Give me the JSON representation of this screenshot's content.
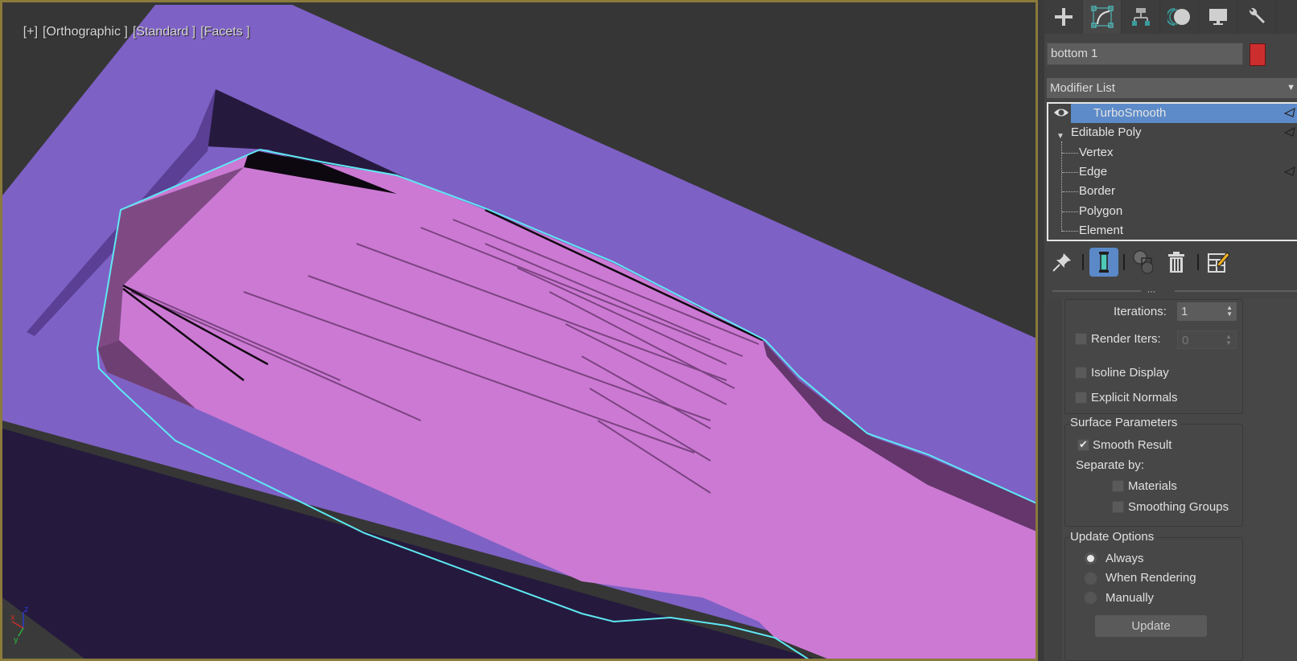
{
  "viewport": {
    "labels": [
      "[+]",
      "[Orthographic ]",
      "[Standard ]",
      "[Facets ]"
    ],
    "gizmo_axes": {
      "x": "x",
      "y": "y",
      "z": "z"
    },
    "colors": {
      "background": "#363636",
      "mold_top": "#7e61c5",
      "mold_shadow": "#251a3d",
      "mold_inner_edge": "#5a3f95",
      "object": "#cc79d4",
      "object_dark": "#7f4a84",
      "selection_outline": "#5ee8f2",
      "frame": "#8a7a3c"
    }
  },
  "command_panel": {
    "tabs": [
      {
        "name": "create",
        "icon": "plus-icon"
      },
      {
        "name": "modify",
        "icon": "modify-curve-icon",
        "active": true
      },
      {
        "name": "hierarchy",
        "icon": "hierarchy-icon"
      },
      {
        "name": "motion",
        "icon": "motion-icon"
      },
      {
        "name": "display",
        "icon": "monitor-icon"
      },
      {
        "name": "utilities",
        "icon": "wrench-icon"
      }
    ],
    "object_name": "bottom 1",
    "object_color": "#cc2e2e",
    "modifier_list_label": "Modifier List",
    "stack": {
      "items": [
        {
          "label": "TurboSmooth",
          "selected": true,
          "visible": true
        },
        {
          "label": "Editable Poly",
          "expanded": true
        },
        {
          "label": "Vertex"
        },
        {
          "label": "Edge"
        },
        {
          "label": "Border"
        },
        {
          "label": "Polygon"
        },
        {
          "label": "Element"
        }
      ]
    },
    "stack_toolbar": [
      {
        "name": "pin-stack",
        "icon": "pin-icon"
      },
      {
        "name": "show-end-result",
        "icon": "end-result-icon",
        "active": true
      },
      {
        "name": "make-unique",
        "icon": "make-unique-icon"
      },
      {
        "name": "remove-modifier",
        "icon": "trash-icon"
      },
      {
        "name": "configure-modifier-sets",
        "icon": "configure-sets-icon"
      }
    ],
    "turbosmooth": {
      "iterations_label": "Iterations:",
      "iterations_value": "1",
      "render_iters_label": "Render Iters:",
      "render_iters_value": "0",
      "render_iters_checked": false,
      "isoline_display_label": "Isoline Display",
      "isoline_display_checked": false,
      "explicit_normals_label": "Explicit Normals",
      "explicit_normals_checked": false,
      "surface_parameters": {
        "title": "Surface Parameters",
        "smooth_result_label": "Smooth Result",
        "smooth_result_checked": true,
        "separate_by_label": "Separate by:",
        "materials_label": "Materials",
        "materials_checked": false,
        "smoothing_groups_label": "Smoothing Groups",
        "smoothing_groups_checked": false
      },
      "update_options": {
        "title": "Update Options",
        "options": [
          "Always",
          "When Rendering",
          "Manually"
        ],
        "selected": "Always",
        "update_button": "Update"
      }
    }
  }
}
